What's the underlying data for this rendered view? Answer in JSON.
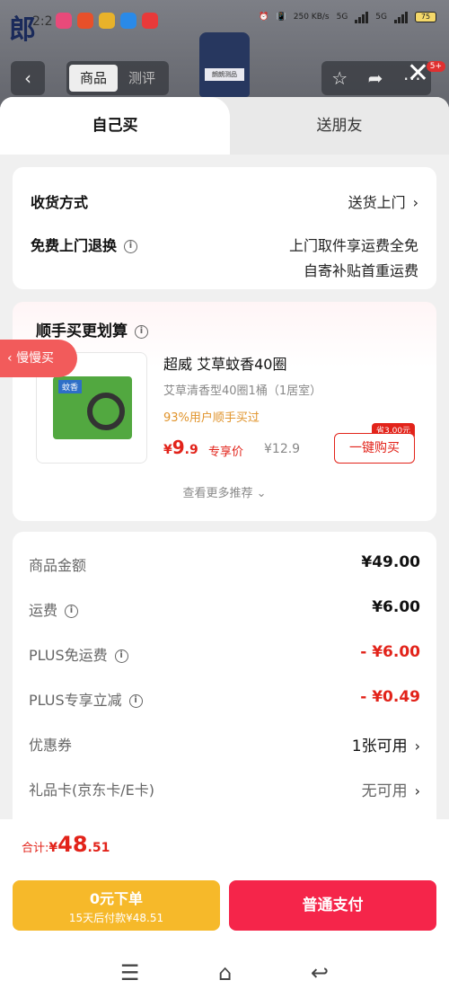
{
  "status_bar": {
    "logo": "郎",
    "time": "2:2",
    "network_speed": "250 KB/s",
    "signal1": "5G",
    "signal2": "5G",
    "battery": "75"
  },
  "product_page": {
    "back_icon": "back-arrow-icon",
    "tabs": [
      "商品",
      "测评"
    ],
    "active_tab": "商品",
    "jar_label": "朗朗测品",
    "message_badge": "5+"
  },
  "sheet": {
    "tabs": [
      "自己买",
      "送朋友"
    ],
    "delivery": {
      "method_label": "收货方式",
      "method_value": "送货上门",
      "return_label": "免费上门退换",
      "return_value_line1": "上门取件享运费全免",
      "return_value_line2": "自寄补贴首重运费"
    },
    "recommend": {
      "title": "顺手买更划算",
      "product_name": "超威 艾草蚊香40圈",
      "product_spec": "艾草清香型40圈1桶（1居室）",
      "buyers": "93%用户顺手买过",
      "price_symbol": "¥",
      "price_int": "9",
      "price_dec": ".9",
      "price_tag": "专享价",
      "original_price": "¥12.9",
      "save_badge": "省3.00元",
      "buy_button": "一键购买",
      "see_more": "查看更多推荐",
      "box_label": "蚊香"
    },
    "side_pill": "慢慢买",
    "costs": [
      {
        "label": "商品金额",
        "value": "¥49.00",
        "style": "bold",
        "info": false
      },
      {
        "label": "运费",
        "value": "¥6.00",
        "style": "bold",
        "info": true
      },
      {
        "label": "PLUS免运费",
        "value": "- ¥6.00",
        "style": "red",
        "info": true
      },
      {
        "label": "PLUS专享立减",
        "value": "- ¥0.49",
        "style": "red",
        "info": true
      },
      {
        "label": "优惠券",
        "value": "1张可用",
        "style": "plain",
        "info": false,
        "chevron": true
      },
      {
        "label": "礼品卡(京东卡/E卡)",
        "value": "无可用",
        "style": "grey",
        "info": false,
        "chevron": true
      }
    ],
    "total": {
      "label": "合计:",
      "symbol": "¥",
      "int": "48",
      "dec": ".51"
    },
    "btn_zero_line1": "0元下单",
    "btn_zero_line2": "15天后付款¥48.51",
    "btn_pay": "普通支付"
  },
  "system_nav": [
    "menu-icon",
    "home-icon",
    "back-icon"
  ],
  "colors": {
    "accent_red": "#e2231a",
    "pay_red": "#f5254a",
    "zero_yellow": "#f6b92a"
  }
}
